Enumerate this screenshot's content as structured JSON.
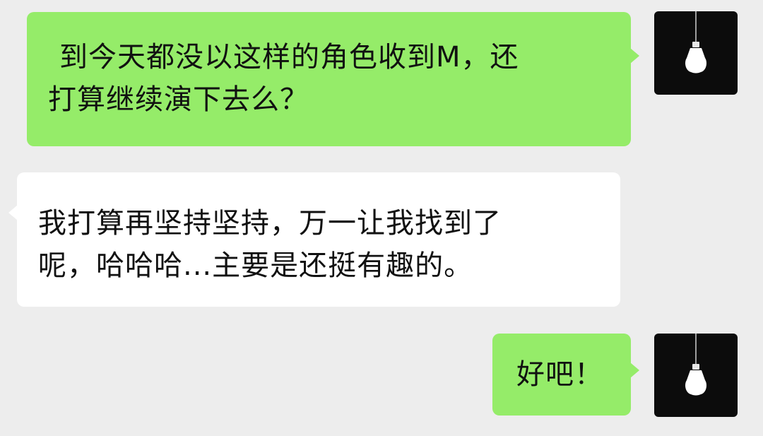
{
  "messages": [
    {
      "side": "sent",
      "lines": [
        "到今天都没以这样的角色收到M，还",
        "打算继续演下去么？"
      ]
    },
    {
      "side": "received",
      "lines": [
        "我打算再坚持坚持，万一让我找到了",
        "呢，哈哈哈...主要是还挺有趣的。"
      ]
    },
    {
      "side": "sent",
      "lines": [
        "好吧！"
      ]
    }
  ],
  "avatar_icon": "light-bulb-icon",
  "colors": {
    "background": "#ededed",
    "sent_bubble": "#95ec69",
    "received_bubble": "#ffffff",
    "avatar_background": "#0c0c0c"
  }
}
